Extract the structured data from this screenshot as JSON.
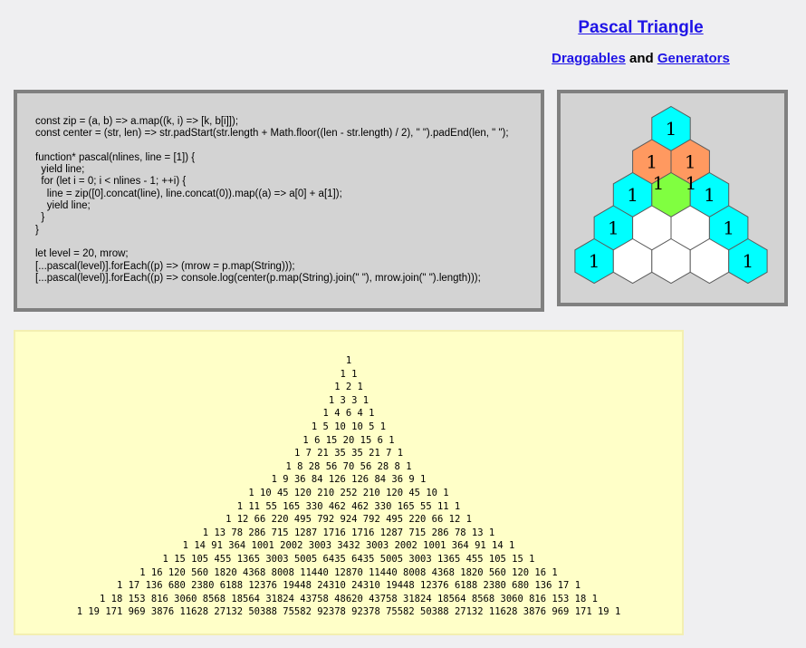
{
  "header": {
    "title": "Pascal Triangle",
    "links": {
      "draggables": "Draggables",
      "and": "and",
      "generators": "Generators"
    }
  },
  "code": "const zip = (a, b) => a.map((k, i) => [k, b[i]]);\nconst center = (str, len) => str.padStart(str.length + Math.floor((len - str.length) / 2), \" \").padEnd(len, \" \");\n\nfunction* pascal(nlines, line = [1]) {\n  yield line;\n  for (let i = 0; i < nlines - 1; ++i) {\n    line = zip([0].concat(line), line.concat(0)).map((a) => a[0] + a[1]);\n    yield line;\n  }\n}\n\nlet level = 20, mrow;\n[...pascal(level)].forEach((p) => (mrow = p.map(String)));\n[...pascal(level)].forEach((p) => console.log(center(p.map(String).join(\" \"), mrow.join(\" \").length)));",
  "triangle": {
    "colors": {
      "edge": "#00ffff",
      "dragged": "#ff9960",
      "sum": "#80ff40",
      "empty": "#ffffff"
    },
    "hexes": [
      {
        "row": 0,
        "col": 0,
        "label": "1",
        "color": "edge"
      },
      {
        "row": 1,
        "col": 0,
        "label": "1",
        "color": "dragged"
      },
      {
        "row": 1,
        "col": 1,
        "label": "1",
        "color": "dragged"
      },
      {
        "row": 2,
        "col": 0,
        "label": "1",
        "color": "edge"
      },
      {
        "row": 2,
        "col": 1,
        "label": "",
        "color": "sum"
      },
      {
        "row": 2,
        "col": 2,
        "label": "1",
        "color": "edge"
      },
      {
        "row": 3,
        "col": 0,
        "label": "1",
        "color": "edge"
      },
      {
        "row": 3,
        "col": 1,
        "label": "",
        "color": "empty"
      },
      {
        "row": 3,
        "col": 2,
        "label": "",
        "color": "empty"
      },
      {
        "row": 3,
        "col": 3,
        "label": "1",
        "color": "edge"
      },
      {
        "row": 4,
        "col": 0,
        "label": "1",
        "color": "edge"
      },
      {
        "row": 4,
        "col": 1,
        "label": "",
        "color": "empty"
      },
      {
        "row": 4,
        "col": 2,
        "label": "",
        "color": "empty"
      },
      {
        "row": 4,
        "col": 3,
        "label": "",
        "color": "empty"
      },
      {
        "row": 4,
        "col": 4,
        "label": "1",
        "color": "edge"
      }
    ],
    "floating_labels": [
      "1",
      "1"
    ]
  },
  "output": [
    "1",
    "1 1",
    "1 2 1",
    "1 3 3 1",
    "1 4 6 4 1",
    "1 5 10 10 5 1",
    "1 6 15 20 15 6 1",
    "1 7 21 35 35 21 7 1",
    "1 8 28 56 70 56 28 8 1",
    "1 9 36 84 126 126 84 36 9 1",
    "1 10 45 120 210 252 210 120 45 10 1",
    "1 11 55 165 330 462 462 330 165 55 11 1",
    "1 12 66 220 495 792 924 792 495 220 66 12 1",
    "1 13 78 286 715 1287 1716 1716 1287 715 286 78 13 1",
    "1 14 91 364 1001 2002 3003 3432 3003 2002 1001 364 91 14 1",
    "1 15 105 455 1365 3003 5005 6435 6435 5005 3003 1365 455 105 15 1",
    "1 16 120 560 1820 4368 8008 11440 12870 11440 8008 4368 1820 560 120 16 1",
    "1 17 136 680 2380 6188 12376 19448 24310 24310 19448 12376 6188 2380 680 136 17 1",
    "1 18 153 816 3060 8568 18564 31824 43758 48620 43758 31824 18564 8568 3060 816 153 18 1",
    "1 19 171 969 3876 11628 27132 50388 75582 92378 92378 75582 50388 27132 11628 3876 969 171 19 1"
  ]
}
